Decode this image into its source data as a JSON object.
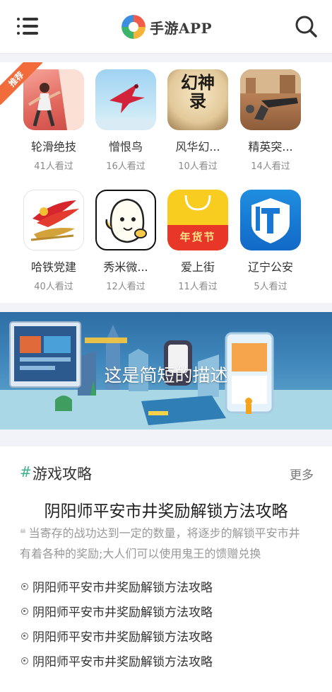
{
  "header": {
    "app_title": "手游APP",
    "menu_icon": "hamburger-menu-icon",
    "search_icon": "search-icon"
  },
  "apps": {
    "badge_label": "推荐",
    "items": [
      {
        "name": "轮滑绝技",
        "views": "41人看过",
        "icon": "roller-skate-game-icon"
      },
      {
        "name": "憎恨鸟",
        "views": "16人看过",
        "icon": "red-bird-icon"
      },
      {
        "name": "风华幻...",
        "views": "10人看过",
        "icon": "fenghua-calligraphy-icon"
      },
      {
        "name": "精英突...",
        "views": "14人看过",
        "icon": "elite-shooter-icon"
      },
      {
        "name": "哈铁党建",
        "views": "40人看过",
        "icon": "party-emblem-train-icon"
      },
      {
        "name": "秀米微...",
        "views": "12人看过",
        "icon": "xiumi-mascot-icon"
      },
      {
        "name": "爱上街",
        "views": "11人看过",
        "icon": "shopping-bag-icon"
      },
      {
        "name": "辽宁公安",
        "views": "5人看过",
        "icon": "liaoning-police-icon"
      }
    ],
    "fenghua_icon_text": "幻神录",
    "shopping_icon_text": "年货节"
  },
  "banner": {
    "caption": "这是简短的描述"
  },
  "guides": {
    "hash": "#",
    "title": "游戏攻略",
    "more": "更多",
    "featured_title": "阴阳师平安市井奖励解锁方法攻略",
    "featured_desc": "当寄存的战功达到一定的数量，将逐步的解锁平安市井有着各种的奖励;大人们可以使用鬼王的馈赠兑换",
    "links": [
      "阴阳师平安市井奖励解锁方法攻略",
      "阴阳师平安市井奖励解锁方法攻略",
      "阴阳师平安市井奖励解锁方法攻略",
      "阴阳师平安市井奖励解锁方法攻略"
    ]
  },
  "colors": {
    "accent": "#3bb28a",
    "badge": "#f26b3a",
    "background": "#f1f3f8"
  }
}
